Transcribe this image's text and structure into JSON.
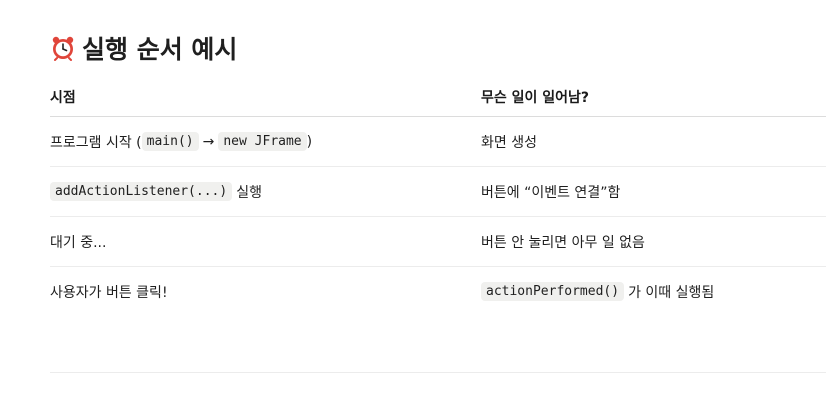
{
  "heading": {
    "icon": "alarm-clock-icon",
    "title": "실행 순서 예시"
  },
  "table": {
    "headers": [
      "시점",
      "무슨 일이 일어남?"
    ],
    "rows": [
      {
        "when_prefix": "프로그램 시작 (",
        "when_code1": "main()",
        "when_arrow": "→",
        "when_code2": "new JFrame",
        "when_suffix": ")",
        "what": "화면 생성"
      },
      {
        "when_code": "addActionListener(...)",
        "when_text": "실행",
        "what": "버튼에 “이벤트 연결”함"
      },
      {
        "when": "대기 중...",
        "what": "버튼 안 눌리면 아무 일 없음"
      },
      {
        "when": "사용자가 버튼 클릭!",
        "what_code": "actionPerformed()",
        "what_text": "가 이때 실행됨"
      }
    ]
  },
  "colors": {
    "code_bg": "#f0f0ee",
    "divider": "#ececec",
    "clock_red": "#e0453a"
  }
}
